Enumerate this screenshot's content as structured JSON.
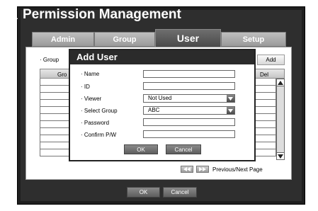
{
  "window": {
    "title": "Permission Management"
  },
  "tabs": [
    {
      "label": "Admin",
      "active": false
    },
    {
      "label": "Group",
      "active": false
    },
    {
      "label": "User",
      "active": true
    },
    {
      "label": "Setup",
      "active": false
    }
  ],
  "panel": {
    "group_label": "· Group",
    "add_label": "Add",
    "columns": {
      "group": "Gro",
      "del": "Del"
    },
    "paging_label": "Previous/Next Page"
  },
  "dialog": {
    "title": "Add User",
    "fields": {
      "name": {
        "label": "· Name",
        "value": ""
      },
      "id": {
        "label": "· ID",
        "value": ""
      },
      "viewer": {
        "label": "· Viewer",
        "value": "Not Used"
      },
      "select_group": {
        "label": "· Select Group",
        "value": "ABC"
      },
      "password": {
        "label": "· Password",
        "value": ""
      },
      "confirm_pw": {
        "label": "· Confirm P/W",
        "value": ""
      }
    },
    "ok_label": "OK",
    "cancel_label": "Cancel"
  },
  "footer": {
    "ok_label": "OK",
    "cancel_label": "Cancel"
  },
  "icons": {
    "title": "user-icon",
    "prev": "rewind-icon",
    "next": "fast-forward-icon",
    "dropdown": "triangle-down-icon"
  }
}
